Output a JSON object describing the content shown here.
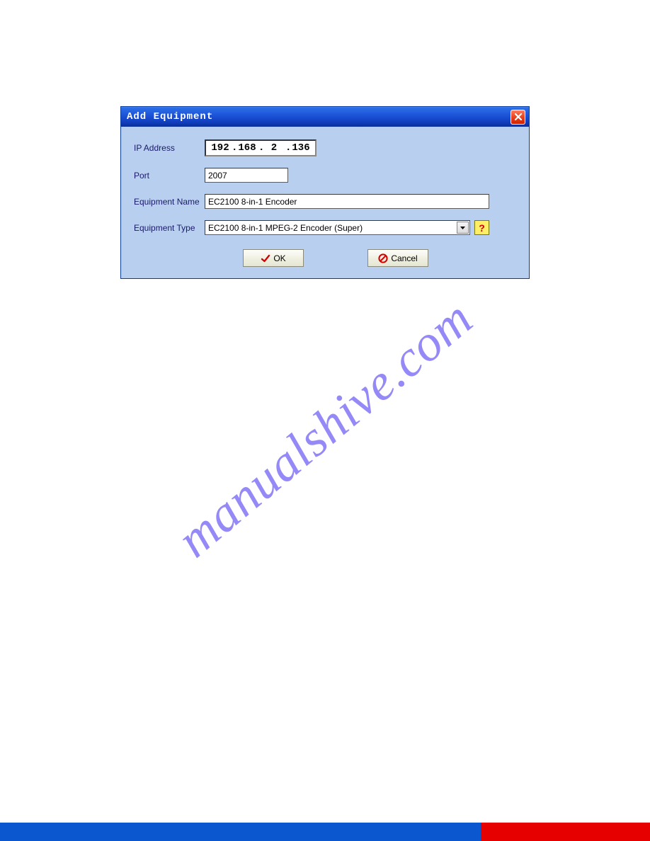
{
  "dialog": {
    "title": "Add Equipment",
    "labels": {
      "ip": "IP Address",
      "port": "Port",
      "eqname": "Equipment Name",
      "eqtype": "Equipment Type"
    },
    "values": {
      "ip": {
        "a": "192",
        "b": "168",
        "c": "2",
        "d": "136"
      },
      "port": "2007",
      "eqname": "EC2100 8-in-1 Encoder",
      "eqtype": "EC2100 8-in-1 MPEG-2 Encoder (Super)"
    },
    "buttons": {
      "ok": "OK",
      "cancel": "Cancel",
      "help": "?"
    }
  },
  "watermark": "manualshive.com"
}
